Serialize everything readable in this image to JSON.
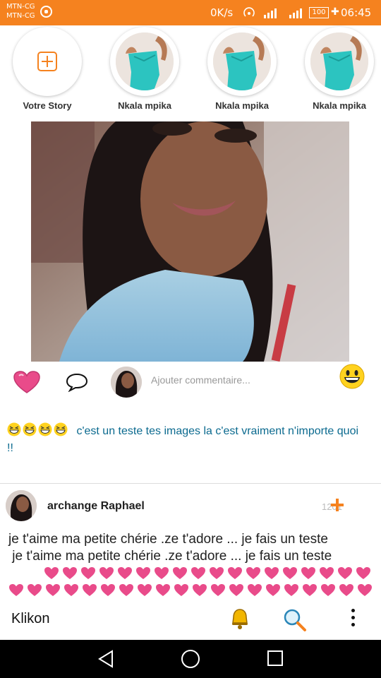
{
  "status_bar": {
    "carrier_1": "MTN-CG",
    "carrier_2": "MTN-CG",
    "speed": "0K/s",
    "battery": "100",
    "time": "06:45",
    "color": "#f5821f"
  },
  "stories": {
    "add_label": "Votre Story",
    "items": [
      {
        "label": "Nkala mpika"
      },
      {
        "label": "Nkala mpika"
      },
      {
        "label": "Nkala mpika"
      }
    ]
  },
  "post1": {
    "comment_placeholder": "Ajouter commentaire...",
    "caption": "c'est un teste tes images la c'est vraiment n'importe quoi !!"
  },
  "post2": {
    "author": "archange Raphael",
    "count": "1201",
    "text": "je t'aime ma petite chérie .ze t'adore ... je fais un teste\n je t'aime ma petite chérie .ze t'adore ... je fais un teste"
  },
  "toolbar": {
    "brand": "Klikon"
  },
  "colors": {
    "accent": "#f5821f",
    "link": "#0b6a8f",
    "heart": "#e94b8a"
  },
  "icons": {
    "like": "heart-icon",
    "comment": "speech-bubble-icon",
    "emoji": "grinning-face-icon",
    "bell": "bell-icon",
    "search": "search-icon",
    "more": "more-vertical-icon"
  }
}
